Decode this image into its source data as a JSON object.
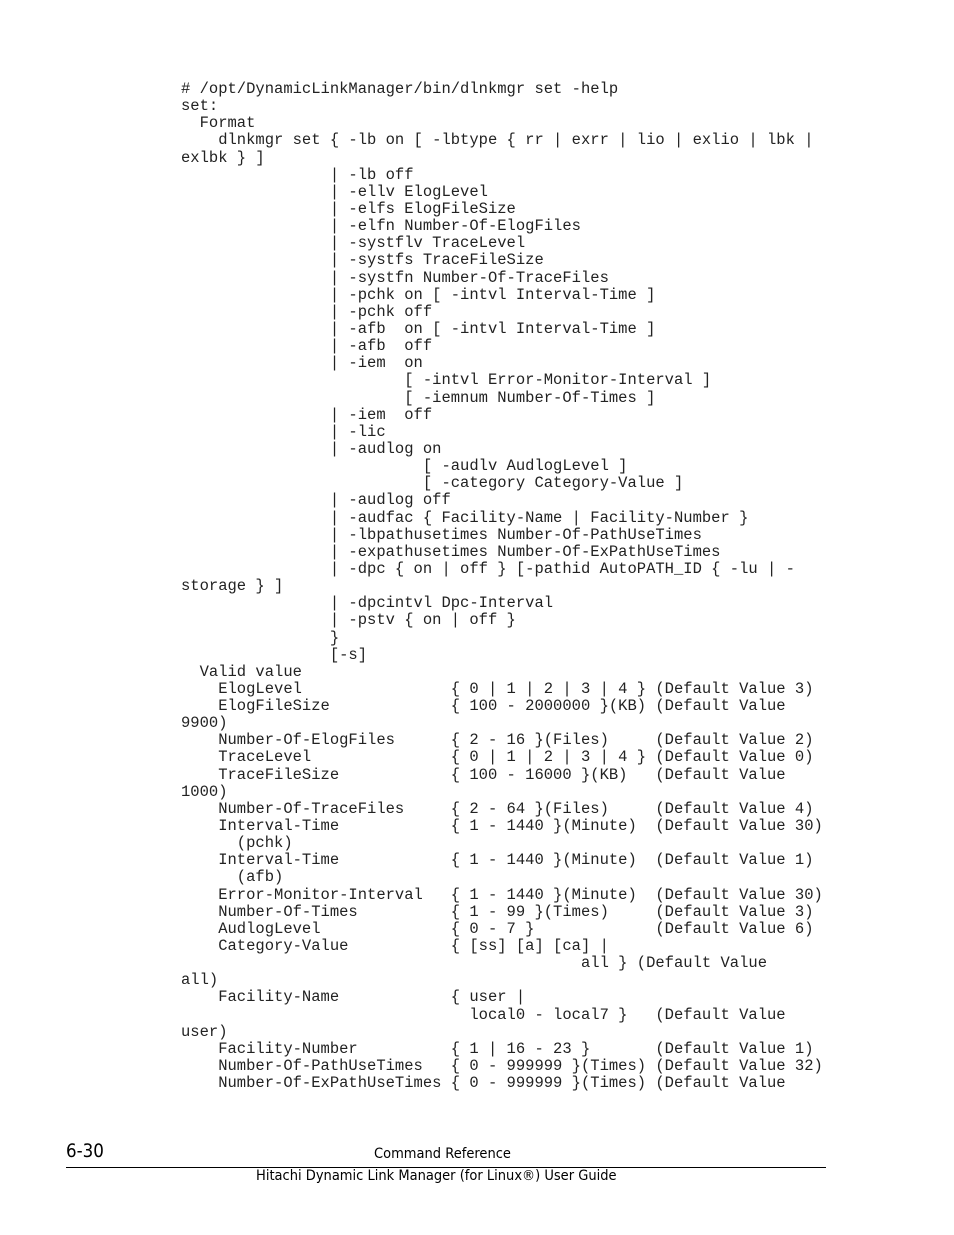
{
  "code_listing": {
    "lines": [
      "# /opt/DynamicLinkManager/bin/dlnkmgr set -help",
      "set:",
      "  Format",
      "    dlnkmgr set { -lb on [ -lbtype { rr | exrr | lio | exlio | lbk |",
      "exlbk } ]",
      "                | -lb off",
      "                | -ellv ElogLevel",
      "                | -elfs ElogFileSize",
      "                | -elfn Number-Of-ElogFiles",
      "                | -systflv TraceLevel",
      "                | -systfs TraceFileSize",
      "                | -systfn Number-Of-TraceFiles",
      "                | -pchk on [ -intvl Interval-Time ]",
      "                | -pchk off",
      "                | -afb  on [ -intvl Interval-Time ]",
      "                | -afb  off",
      "                | -iem  on",
      "                        [ -intvl Error-Monitor-Interval ]",
      "                        [ -iemnum Number-Of-Times ]",
      "                | -iem  off",
      "                | -lic",
      "                | -audlog on",
      "                          [ -audlv AudlogLevel ]",
      "                          [ -category Category-Value ]",
      "                | -audlog off",
      "                | -audfac { Facility-Name | Facility-Number }",
      "                | -lbpathusetimes Number-Of-PathUseTimes",
      "                | -expathusetimes Number-Of-ExPathUseTimes",
      "                | -dpc { on | off } [-pathid AutoPATH_ID { -lu | -",
      "storage } ]",
      "                | -dpcintvl Dpc-Interval",
      "                | -pstv { on | off }",
      "                }",
      "                [-s]",
      "  Valid value",
      "    ElogLevel                { 0 | 1 | 2 | 3 | 4 } (Default Value 3)",
      "    ElogFileSize             { 100 - 2000000 }(KB) (Default Value",
      "9900)",
      "    Number-Of-ElogFiles      { 2 - 16 }(Files)     (Default Value 2)",
      "    TraceLevel               { 0 | 1 | 2 | 3 | 4 } (Default Value 0)",
      "    TraceFileSize            { 100 - 16000 }(KB)   (Default Value",
      "1000)",
      "    Number-Of-TraceFiles     { 2 - 64 }(Files)     (Default Value 4)",
      "    Interval-Time            { 1 - 1440 }(Minute)  (Default Value 30)",
      "      (pchk)",
      "    Interval-Time            { 1 - 1440 }(Minute)  (Default Value 1)",
      "      (afb)",
      "    Error-Monitor-Interval   { 1 - 1440 }(Minute)  (Default Value 30)",
      "    Number-Of-Times          { 1 - 99 }(Times)     (Default Value 3)",
      "    AudlogLevel              { 0 - 7 }             (Default Value 6)",
      "    Category-Value           { [ss] [a] [ca] |",
      "                                           all } (Default Value",
      "all)",
      "    Facility-Name            { user |",
      "                               local0 - local7 }   (Default Value",
      "user)",
      "    Facility-Number          { 1 | 16 - 23 }       (Default Value 1)",
      "    Number-Of-PathUseTimes   { 0 - 999999 }(Times) (Default Value 32)",
      "    Number-Of-ExPathUseTimes { 0 - 999999 }(Times) (Default Value"
    ]
  },
  "footer": {
    "page_number": "6-30",
    "section_title": "Command Reference",
    "book_title": "Hitachi Dynamic Link Manager (for Linux®) User Guide"
  }
}
